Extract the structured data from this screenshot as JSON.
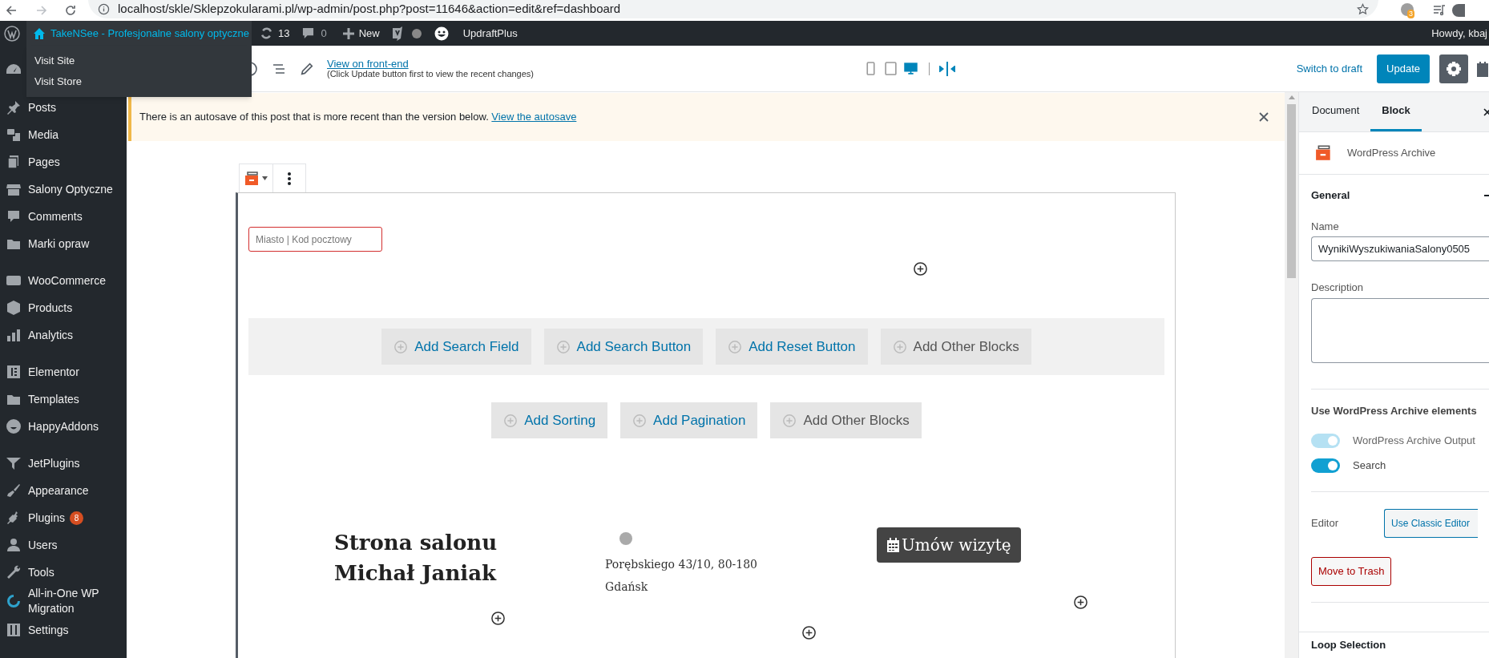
{
  "browser": {
    "url": "localhost/skle/Sklepzokularami.pl/wp-admin/post.php?post=11646&action=edit&ref=dashboard",
    "extension_badge": "3"
  },
  "admin_bar": {
    "site_title": "TakeNSee - Profesjonalne salony optyczne",
    "updates": "13",
    "comments": "0",
    "new_label": "New",
    "plugin_label": "UpdraftPlus",
    "greeting": "Howdy, kbaj",
    "site_menu": [
      "Visit Site",
      "Visit Store"
    ]
  },
  "sidebar": {
    "groups": [
      [
        {
          "label": "Posts"
        },
        {
          "label": "Media"
        },
        {
          "label": "Pages"
        },
        {
          "label": "Salony Optyczne"
        },
        {
          "label": "Comments"
        },
        {
          "label": "Marki opraw"
        }
      ],
      [
        {
          "label": "WooCommerce"
        },
        {
          "label": "Products"
        },
        {
          "label": "Analytics"
        }
      ],
      [
        {
          "label": "Elementor"
        },
        {
          "label": "Templates"
        },
        {
          "label": "HappyAddons"
        }
      ],
      [
        {
          "label": "JetPlugins"
        },
        {
          "label": "Appearance"
        },
        {
          "label": "Plugins",
          "badge": "8"
        },
        {
          "label": "Users"
        },
        {
          "label": "Tools"
        },
        {
          "label": "All-in-One WP Migration"
        },
        {
          "label": "Settings"
        }
      ]
    ]
  },
  "editor_toolbar": {
    "view_link": "View on front-end",
    "view_note": "(Click Update button first to view the recent changes)",
    "devices": [
      {
        "selected": false
      },
      {
        "selected": false
      },
      {
        "selected": true
      }
    ],
    "switch_to_draft": "Switch to draft",
    "update": "Update",
    "settings_selected": true
  },
  "notice": {
    "text": "There is an autosave of this post that is more recent than the version below.",
    "link": "View the autosave"
  },
  "block": {
    "search_placeholder": "Miasto | Kod pocztowy",
    "search_actions": [
      {
        "label": "Add Search Field",
        "kind": "add"
      },
      {
        "label": "Add Search Button",
        "kind": "add"
      },
      {
        "label": "Add Reset Button",
        "kind": "add"
      },
      {
        "label": "Add Other Blocks",
        "kind": "other"
      }
    ],
    "loop_actions": [
      {
        "label": "Add Sorting",
        "kind": "add"
      },
      {
        "label": "Add Pagination",
        "kind": "add"
      },
      {
        "label": "Add Other Blocks",
        "kind": "other"
      }
    ],
    "item": {
      "title": "Strona salonu Michał Janiak",
      "address": "Porębskiego 43/10, 80-180 Gdańsk",
      "button": "Umów wizytę"
    }
  },
  "settings_panel": {
    "tabs": [
      {
        "label": "Document",
        "selected": false
      },
      {
        "label": "Block",
        "selected": true
      }
    ],
    "block_title": "WordPress Archive",
    "general_title": "General",
    "name_label": "Name",
    "name_value": "WynikiWyszukiwaniaSalony0505",
    "description_label": "Description",
    "elements_title": "Use WordPress Archive elements",
    "toggles": [
      {
        "label": "WordPress Archive Output",
        "on": true,
        "disabled": true
      },
      {
        "label": "Search",
        "on": true,
        "disabled": false
      }
    ],
    "editor_label": "Editor",
    "classic_editor_button": "Use Classic Editor",
    "trash_button": "Move to Trash",
    "loop_title": "Loop Selection"
  }
}
